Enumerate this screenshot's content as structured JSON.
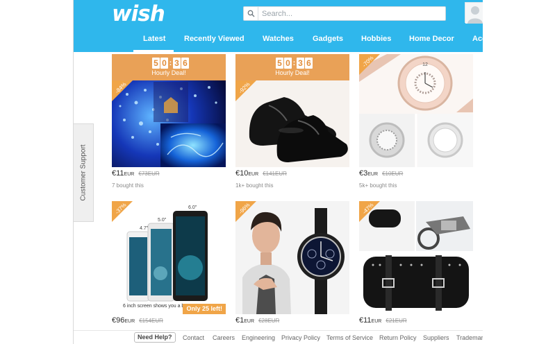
{
  "header": {
    "logo": "wish",
    "search_placeholder": "Search...",
    "tabs": [
      "Latest",
      "Recently Viewed",
      "Watches",
      "Gadgets",
      "Hobbies",
      "Home Decor",
      "Acc"
    ]
  },
  "deal": {
    "digits": [
      "5",
      "0",
      "3",
      "6"
    ],
    "label": "Hourly Deal!"
  },
  "products": [
    {
      "price": "€11",
      "unit": "EUR",
      "old_price": "€73EUR",
      "sold": "7 bought this",
      "discount": "-84%"
    },
    {
      "price": "€10",
      "unit": "EUR",
      "old_price": "€141EUR",
      "sold": "1k+ bought this",
      "discount": "-92%"
    },
    {
      "price": "€3",
      "unit": "EUR",
      "old_price": "€10EUR",
      "sold": "5k+ bought this",
      "discount": "-70%"
    },
    {
      "price": "€96",
      "unit": "EUR",
      "old_price": "€154EUR",
      "sold": "",
      "discount": "-37%",
      "stock_note": "Only 25 left!",
      "caption": "6 inch screen shows you a b"
    },
    {
      "price": "€1",
      "unit": "EUR",
      "old_price": "€28EUR",
      "sold": "",
      "discount": "-96%"
    },
    {
      "price": "€11",
      "unit": "EUR",
      "old_price": "€21EUR",
      "sold": "",
      "discount": "-47%"
    }
  ],
  "phone_sizes": [
    "4.7\"",
    "5.0\"",
    "6.0\""
  ],
  "support_label": "Customer Support",
  "footer": {
    "help": "Need Help?",
    "links": [
      "Contact",
      "Careers",
      "Engineering",
      "Privacy Policy",
      "Terms of Service",
      "Return Policy",
      "Suppliers",
      "Trademark"
    ]
  },
  "colors": {
    "header": "#2fb7ec",
    "deal": "#e9a157",
    "badge": "#f0a548"
  }
}
